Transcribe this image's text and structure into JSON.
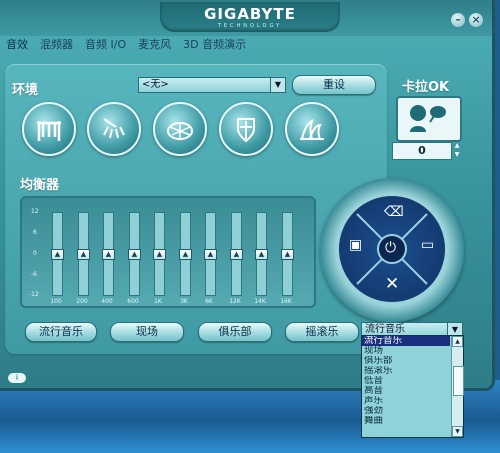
{
  "brand": {
    "name": "GIGABYTE",
    "sub": "TECHNOLOGY"
  },
  "titlebar": {
    "minimize_label": "–",
    "close_label": "×"
  },
  "tabs": [
    "音效",
    "混频器",
    "音频 I/O",
    "麦克风",
    "3D 音频演示"
  ],
  "environment": {
    "title": "环境",
    "select_value": "<无>",
    "reset_label": "重设",
    "icons": [
      "bridge-icon",
      "shower-icon",
      "stadium-icon",
      "armor-icon",
      "opera-house-icon"
    ]
  },
  "karaoke": {
    "title": "卡拉OK",
    "value": "0"
  },
  "equalizer": {
    "title": "均衡器",
    "db_labels": [
      "12",
      "6",
      "0",
      "-6",
      "-12"
    ],
    "bands": [
      {
        "freq": "100",
        "level": 0,
        "thumb": "▲"
      },
      {
        "freq": "200",
        "level": 0,
        "thumb": "▲"
      },
      {
        "freq": "400",
        "level": 0,
        "thumb": "▲"
      },
      {
        "freq": "600",
        "level": 0,
        "thumb": "▲"
      },
      {
        "freq": "1K",
        "level": 0,
        "thumb": "▲"
      },
      {
        "freq": "3K",
        "level": 0,
        "thumb": "▲"
      },
      {
        "freq": "6K",
        "level": 0,
        "thumb": "▲"
      },
      {
        "freq": "12K",
        "level": 0,
        "thumb": "▲"
      },
      {
        "freq": "14K",
        "level": 0,
        "thumb": "▲"
      },
      {
        "freq": "16K",
        "level": 0,
        "thumb": "▲"
      }
    ],
    "presets": [
      "流行音乐",
      "现场",
      "俱乐部",
      "摇滚乐"
    ],
    "dropdown_value": "流行音乐",
    "dropdown_options": [
      "流行音乐",
      "现场",
      "俱乐部",
      "摇滚乐",
      "低音",
      "高音",
      "声乐",
      "强劲",
      "舞曲"
    ]
  },
  "colors": {
    "panel": "#57b5bd",
    "list_selection": "#1a2f80",
    "control_center": "#1d4f8e"
  }
}
